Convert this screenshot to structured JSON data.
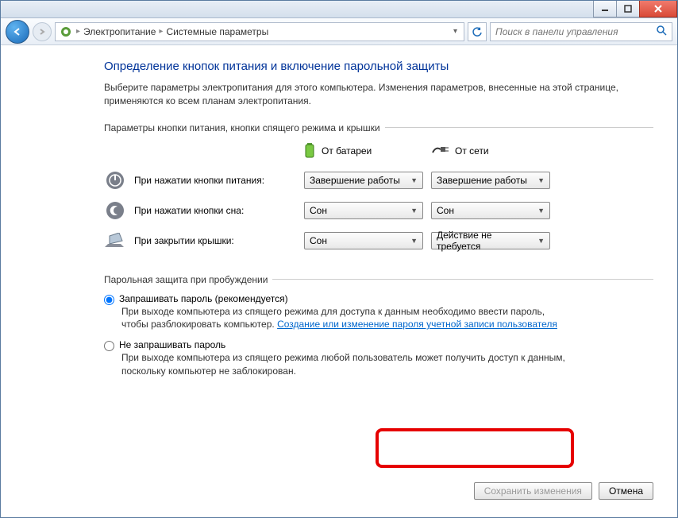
{
  "breadcrumb": {
    "item1": "Электропитание",
    "item2": "Системные параметры"
  },
  "search": {
    "placeholder": "Поиск в панели управления"
  },
  "page": {
    "title": "Определение кнопок питания и включение парольной защиты",
    "intro": "Выберите параметры электропитания для этого компьютера. Изменения параметров, внесенные на этой странице, применяются ко всем планам электропитания."
  },
  "buttons_section": {
    "legend": "Параметры кнопки питания, кнопки спящего режима и крышки",
    "col_battery": "От батареи",
    "col_ac": "От сети",
    "power_button": {
      "label": "При нажатии кнопки питания:",
      "battery": "Завершение работы",
      "ac": "Завершение работы"
    },
    "sleep_button": {
      "label": "При нажатии кнопки сна:",
      "battery": "Сон",
      "ac": "Сон"
    },
    "lid_close": {
      "label": "При закрытии крышки:",
      "battery": "Сон",
      "ac": "Действие не требуется"
    }
  },
  "password_section": {
    "legend": "Парольная защита при пробуждении",
    "require": {
      "label": "Запрашивать пароль (рекомендуется)",
      "desc_before": "При выходе компьютера из спящего режима для доступа к данным необходимо ввести пароль, чтобы разблокировать компьютер. ",
      "link": "Создание или изменение пароля учетной записи пользователя"
    },
    "norequire": {
      "label": "Не запрашивать пароль",
      "desc": "При выходе компьютера из спящего режима любой пользователь может получить доступ к данным, поскольку компьютер не заблокирован."
    }
  },
  "footer": {
    "save": "Сохранить изменения",
    "cancel": "Отмена"
  }
}
